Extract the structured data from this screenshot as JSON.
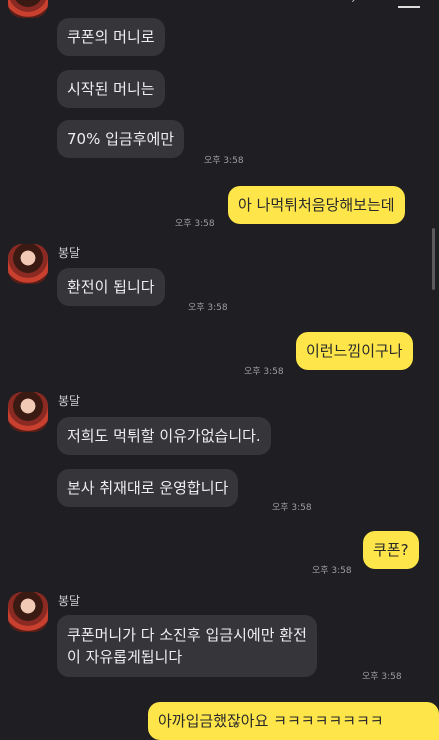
{
  "nav": {
    "back_icon": "chevron-left-icon",
    "search_icon": "search-icon",
    "menu_icon": "menu-icon"
  },
  "messages": [
    {
      "type": "in",
      "text": "쿠폰의 머니로"
    },
    {
      "type": "in",
      "text": "시작된 머니는"
    },
    {
      "type": "in",
      "text": "70% 입금후에만",
      "time": "오후 3:58"
    },
    {
      "type": "out",
      "text": "아 나먹튀처음당해보는데",
      "time": "오후 3:58"
    },
    {
      "type": "in",
      "sender": "봉달",
      "text": "환전이 됩니다",
      "time": "오후 3:58"
    },
    {
      "type": "out",
      "text": "이런느낌이구나",
      "time": "오후 3:58"
    },
    {
      "type": "in",
      "sender": "봉달",
      "text": "저희도 먹튀할 이유가없습니다."
    },
    {
      "type": "in",
      "text": "본사 취재대로 운영합니다",
      "time": "오후 3:58"
    },
    {
      "type": "out",
      "text": "쿠폰?",
      "time": "오후 3:58"
    },
    {
      "type": "in",
      "sender": "봉달",
      "text_line1": "쿠폰머니가 다 소진후 입금시에만 환전",
      "text_line2": "이 자유롭게됩니다",
      "time": "오후 3:58"
    },
    {
      "type": "out",
      "text": "아까입금했잖아요 ㅋㅋㅋㅋㅋㅋㅋㅋ"
    }
  ]
}
